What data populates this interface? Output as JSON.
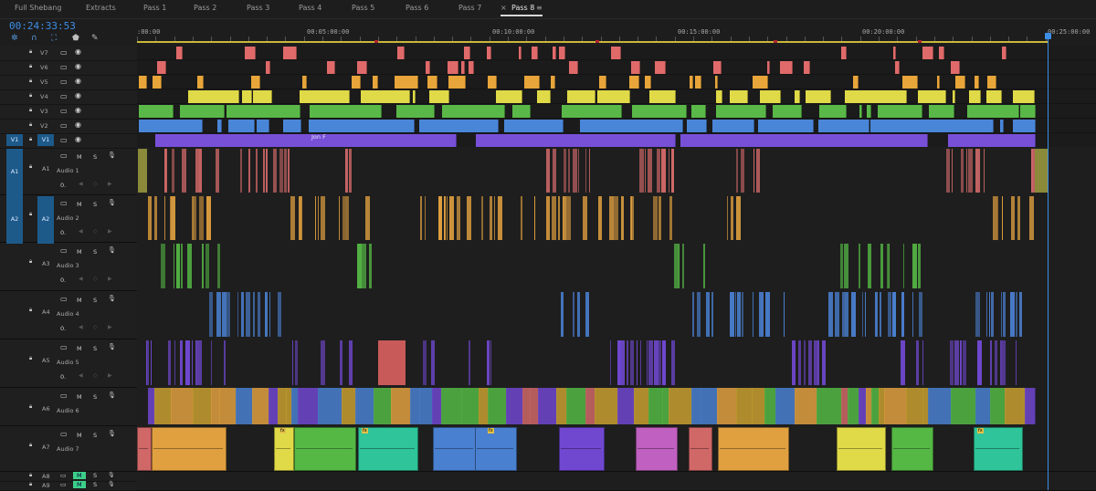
{
  "tabs": [
    {
      "label": "Full Shebang",
      "active": false
    },
    {
      "label": "Extracts",
      "active": false
    },
    {
      "label": "Pass 1",
      "active": false
    },
    {
      "label": "Pass 2",
      "active": false
    },
    {
      "label": "Pass 3",
      "active": false
    },
    {
      "label": "Pass 4",
      "active": false
    },
    {
      "label": "Pass 5",
      "active": false
    },
    {
      "label": "Pass 6",
      "active": false
    },
    {
      "label": "Pass 7",
      "active": false
    },
    {
      "label": "Pass 8",
      "active": true,
      "close": "×",
      "menu": "≡"
    }
  ],
  "timecode": "00:24:33:53",
  "ruler_labels": [
    ":00:00",
    "00:05:00:00",
    "00:10:00:00",
    "00:15:00:00",
    "00:20:00:00",
    "00:25:00:00"
  ],
  "video_tracks": [
    {
      "id": "V7",
      "color": "#e06a6a"
    },
    {
      "id": "V6",
      "color": "#e06a6a"
    },
    {
      "id": "V5",
      "color": "#e8a53a"
    },
    {
      "id": "V4",
      "color": "#e0da48"
    },
    {
      "id": "V3",
      "color": "#5ab848"
    },
    {
      "id": "V2",
      "color": "#4a86d8"
    },
    {
      "id": "V1",
      "color": "#7850d8"
    }
  ],
  "video_source_label": "V1",
  "audio_tracks": [
    {
      "id": "A1",
      "name": "Audio 1",
      "level": "0.",
      "src": "A1",
      "color": "#d06868"
    },
    {
      "id": "A2",
      "name": "Audio 2",
      "level": "0.",
      "src": "A2",
      "color": "#e0a040"
    },
    {
      "id": "A3",
      "name": "Audio 3",
      "level": "0.",
      "src": "",
      "color": "#55b845"
    },
    {
      "id": "A4",
      "name": "Audio 4",
      "level": "0.",
      "src": "",
      "color": "#4a80d0"
    },
    {
      "id": "A5",
      "name": "Audio 5",
      "level": "0.",
      "src": "",
      "color": "#7048d0"
    },
    {
      "id": "A6",
      "name": "Audio 6",
      "level": "",
      "src": "",
      "color": "#c8a030"
    },
    {
      "id": "A7",
      "name": "Audio 7",
      "level": "",
      "src": "",
      "color": "#e0a040"
    }
  ],
  "extra_tracks": [
    {
      "id": "A8"
    },
    {
      "id": "A9"
    }
  ],
  "buttons": {
    "mute": "M",
    "solo": "S"
  },
  "clip_labels": {
    "v1": "Jon F",
    "fx": "fx",
    "L": "L",
    "R": "R"
  },
  "colors": {
    "accent": "#3d8ee6",
    "selected": "#1d5a8a"
  }
}
